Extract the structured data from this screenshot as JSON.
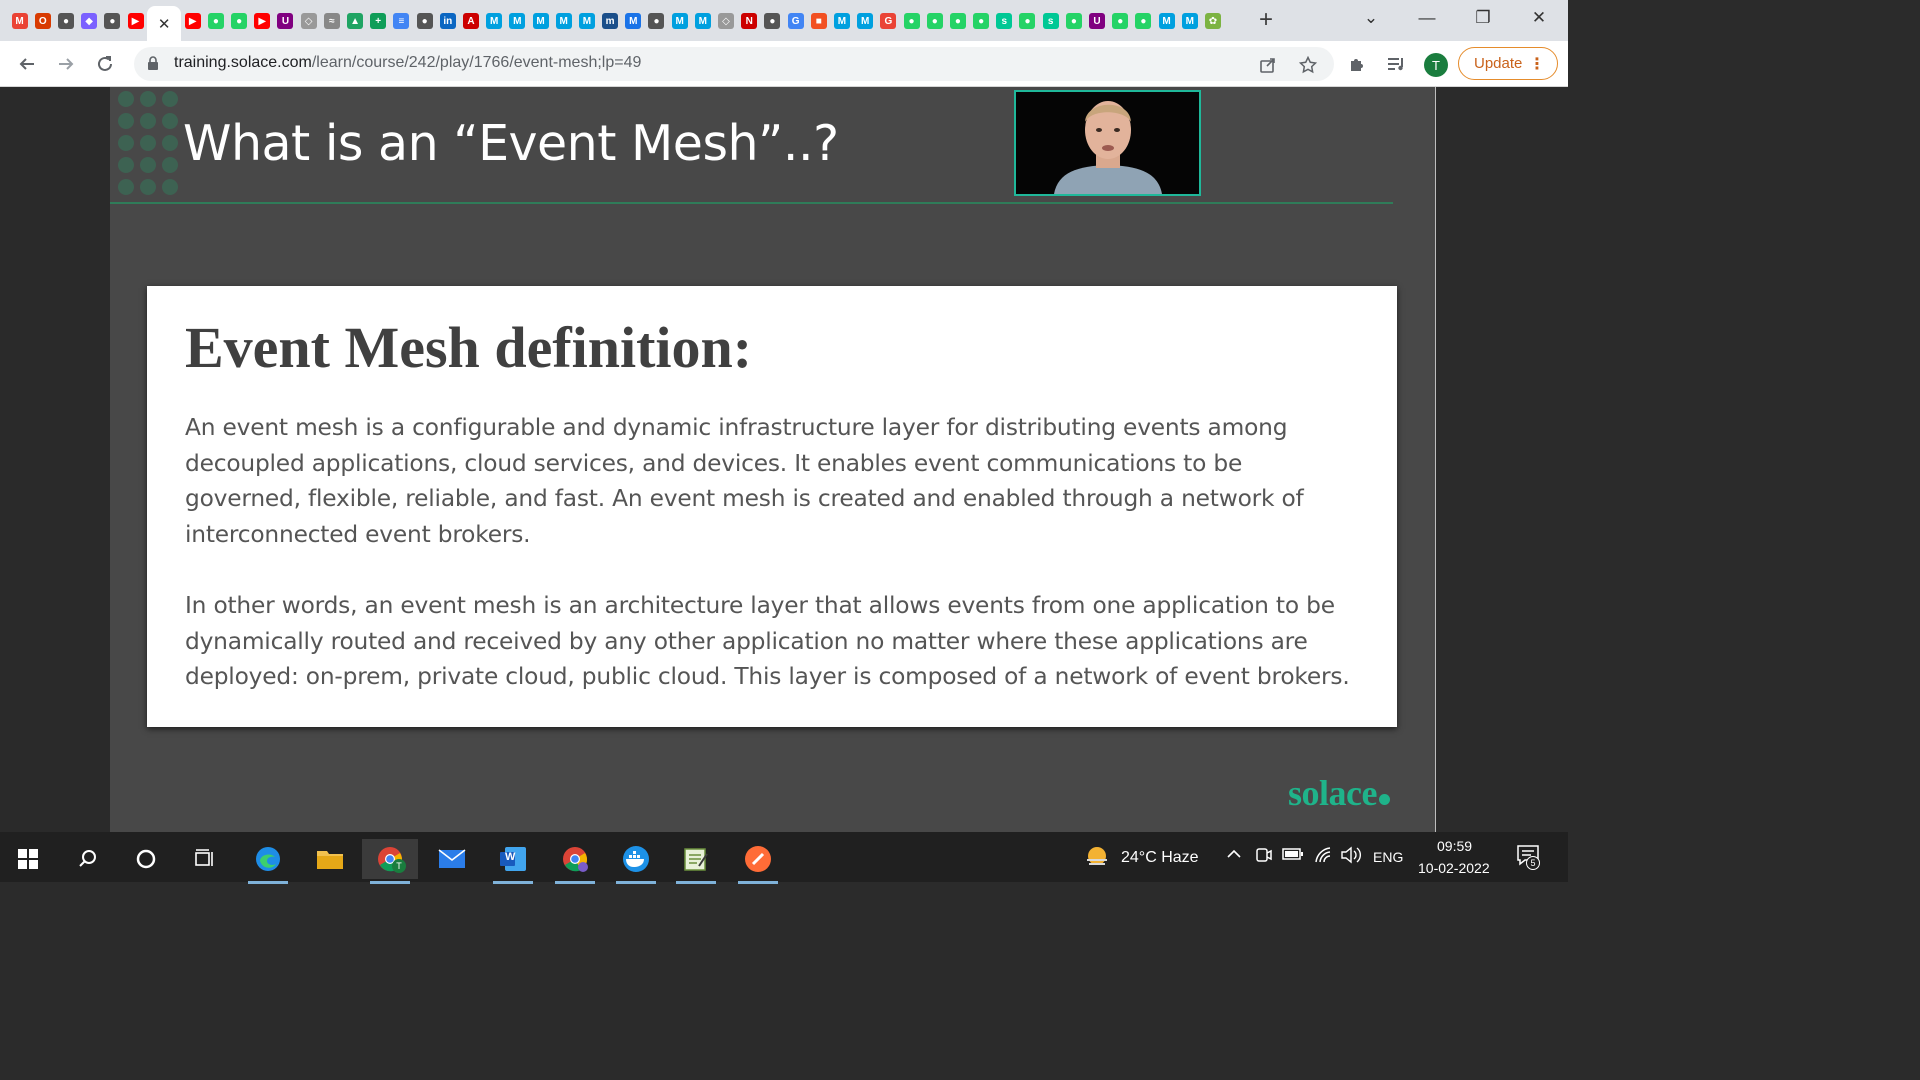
{
  "browser": {
    "active_tab_close": "✕",
    "new_tab": "+",
    "window_controls": {
      "tab_search": "⌄",
      "minimize": "—",
      "restore": "❐",
      "close": "✕"
    },
    "url_host": "training.solace.com",
    "url_path": "/learn/course/242/play/1766/event-mesh;lp=49",
    "profile_initial": "T",
    "update_label": "Update",
    "update_menu": "⋮",
    "favicons": [
      {
        "icon": "gmail-icon",
        "glyph": "M",
        "color": "#ea4335"
      },
      {
        "icon": "office-icon",
        "glyph": "O",
        "color": "#d83b01"
      },
      {
        "icon": "chrome-icon",
        "glyph": "●",
        "color": "#555"
      },
      {
        "icon": "dev-icon",
        "glyph": "◆",
        "color": "#7b61ff"
      },
      {
        "icon": "docker-icon",
        "glyph": "●",
        "color": "#555"
      },
      {
        "icon": "youtube-icon",
        "glyph": "▶",
        "color": "#ff0000"
      },
      {
        "icon": "youtube-icon",
        "glyph": "▶",
        "color": "#ff0000"
      },
      {
        "icon": "whatsapp-icon",
        "glyph": "●",
        "color": "#25d366"
      },
      {
        "icon": "whatsapp-icon",
        "glyph": "●",
        "color": "#25d366"
      },
      {
        "icon": "youtube-icon",
        "glyph": "▶",
        "color": "#ff0000"
      },
      {
        "icon": "ublock-icon",
        "glyph": "U",
        "color": "#800080"
      },
      {
        "icon": "extension-icon",
        "glyph": "◇",
        "color": "#999"
      },
      {
        "icon": "docs-icon",
        "glyph": "≈",
        "color": "#888"
      },
      {
        "icon": "drive-icon",
        "glyph": "▲",
        "color": "#1fa463"
      },
      {
        "icon": "sheets-icon",
        "glyph": "+",
        "color": "#0f9d58"
      },
      {
        "icon": "docs-icon",
        "glyph": "≡",
        "color": "#4285f4"
      },
      {
        "icon": "chrome-icon",
        "glyph": "●",
        "color": "#555"
      },
      {
        "icon": "linkedin-icon",
        "glyph": "in",
        "color": "#0a66c2"
      },
      {
        "icon": "amc-icon",
        "glyph": "A",
        "color": "#c00"
      },
      {
        "icon": "mulesoft-icon",
        "glyph": "M",
        "color": "#00a0df"
      },
      {
        "icon": "mulesoft-icon",
        "glyph": "M",
        "color": "#00a0df"
      },
      {
        "icon": "mulesoft-icon",
        "glyph": "M",
        "color": "#00a0df"
      },
      {
        "icon": "mulesoft-icon",
        "glyph": "M",
        "color": "#00a0df"
      },
      {
        "icon": "mulesoft-icon",
        "glyph": "M",
        "color": "#00a0df"
      },
      {
        "icon": "mvn-icon",
        "glyph": "m",
        "color": "#1b4f8a"
      },
      {
        "icon": "medium-icon",
        "glyph": "M",
        "color": "#1a73e8"
      },
      {
        "icon": "chrome-icon",
        "glyph": "●",
        "color": "#555"
      },
      {
        "icon": "mulesoft-icon",
        "glyph": "M",
        "color": "#00a0df"
      },
      {
        "icon": "mulesoft-icon",
        "glyph": "M",
        "color": "#00a0df"
      },
      {
        "icon": "extension-icon",
        "glyph": "◇",
        "color": "#999"
      },
      {
        "icon": "notion-icon",
        "glyph": "N",
        "color": "#c00"
      },
      {
        "icon": "chrome-icon",
        "glyph": "●",
        "color": "#555"
      },
      {
        "icon": "google-icon",
        "glyph": "G",
        "color": "#4285f4"
      },
      {
        "icon": "microsoft-icon",
        "glyph": "■",
        "color": "#f25022"
      },
      {
        "icon": "mulesoft-icon",
        "glyph": "M",
        "color": "#00a0df"
      },
      {
        "icon": "mulesoft-icon",
        "glyph": "M",
        "color": "#00a0df"
      },
      {
        "icon": "google-icon",
        "glyph": "G",
        "color": "#ea4335"
      },
      {
        "icon": "whatsapp-icon",
        "glyph": "●",
        "color": "#25d366"
      },
      {
        "icon": "whatsapp-icon",
        "glyph": "●",
        "color": "#25d366"
      },
      {
        "icon": "whatsapp-icon",
        "glyph": "●",
        "color": "#25d366"
      },
      {
        "icon": "whatsapp-icon",
        "glyph": "●",
        "color": "#25d366"
      },
      {
        "icon": "solace-icon",
        "glyph": "s",
        "color": "#00c895"
      },
      {
        "icon": "whatsapp-icon",
        "glyph": "●",
        "color": "#25d366"
      },
      {
        "icon": "solace-icon",
        "glyph": "s",
        "color": "#00c895"
      },
      {
        "icon": "whatsapp-icon",
        "glyph": "●",
        "color": "#25d366"
      },
      {
        "icon": "ublock-icon",
        "glyph": "U",
        "color": "#800080"
      },
      {
        "icon": "whatsapp-icon",
        "glyph": "●",
        "color": "#25d366"
      },
      {
        "icon": "whatsapp-icon",
        "glyph": "●",
        "color": "#25d366"
      },
      {
        "icon": "mulesoft-icon",
        "glyph": "M",
        "color": "#00a0df"
      },
      {
        "icon": "mulesoft-icon",
        "glyph": "M",
        "color": "#00a0df"
      },
      {
        "icon": "puzzle-icon",
        "glyph": "✿",
        "color": "#7cb342"
      }
    ]
  },
  "slide": {
    "title": "What is an “Event Mesh”..?",
    "card_heading": "Event Mesh definition:",
    "paragraph_1": "An event mesh is a configurable and dynamic infrastructure layer for distributing events among decoupled applications, cloud services, and devices.  It enables event communications to be governed, flexible, reliable, and fast.  An event mesh is created and enabled through a network of interconnected event brokers.",
    "paragraph_2": "In other words, an event mesh is an architecture layer that allows events from one application to be dynamically routed and received by any other application no matter where these applications are deployed: on-prem, private cloud, public cloud.  This layer is composed of a network of event brokers.",
    "brand": "solace"
  },
  "taskbar": {
    "weather": "24°C  Haze",
    "language": "ENG",
    "time": "09:59",
    "date": "10-02-2022",
    "notification_count": "5",
    "chrome_badge": "T",
    "word_badge": "W"
  },
  "colors": {
    "accent_green": "#1fb38a",
    "update_orange": "#e58c2c",
    "slide_bg": "#484848"
  }
}
